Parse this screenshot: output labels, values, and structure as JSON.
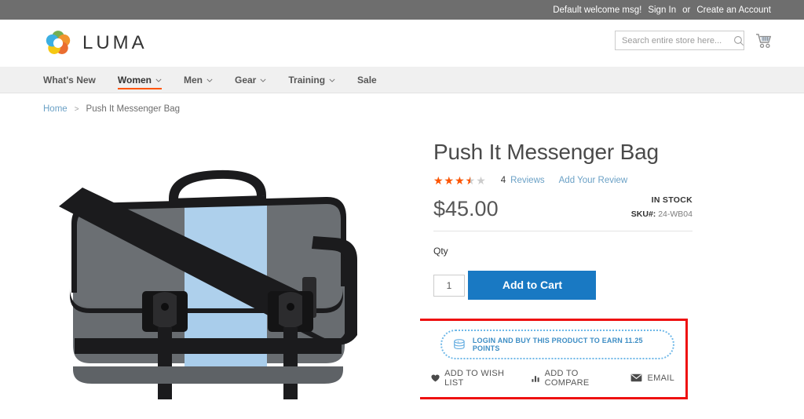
{
  "top_panel": {
    "welcome": "Default welcome msg!",
    "sign_in": "Sign In",
    "or": "or",
    "create_account": "Create an Account"
  },
  "header": {
    "logo_text": "LUMA",
    "logo_icon": "luma-flower-logo",
    "search": {
      "placeholder": "Search entire store here...",
      "value": "",
      "icon": "search-icon"
    },
    "cart_icon": "shopping-cart-icon"
  },
  "nav": {
    "items": [
      {
        "label": "What's New",
        "has_chevron": false,
        "active": false
      },
      {
        "label": "Women",
        "has_chevron": true,
        "active": true
      },
      {
        "label": "Men",
        "has_chevron": true,
        "active": false
      },
      {
        "label": "Gear",
        "has_chevron": true,
        "active": false
      },
      {
        "label": "Training",
        "has_chevron": true,
        "active": false
      },
      {
        "label": "Sale",
        "has_chevron": false,
        "active": false
      }
    ]
  },
  "breadcrumb": {
    "home": "Home",
    "separator": ">",
    "current": "Push It Messenger Bag"
  },
  "product": {
    "title": "Push It Messenger Bag",
    "rating_value": 3.5,
    "rating_max": 5,
    "rating_percent": 70,
    "review_count": "4",
    "reviews_label": "Reviews",
    "add_review_label": "Add Your Review",
    "price": "$45.00",
    "availability": "IN STOCK",
    "sku_label": "SKU#:",
    "sku_value": "24-WB04",
    "qty_label": "Qty",
    "qty_value": "1",
    "add_to_cart_label": "Add to Cart",
    "image_alt": "Push It Messenger Bag gray and light blue messenger bag"
  },
  "reward": {
    "badge_text": "LOGIN AND BUY THIS PRODUCT TO EARN 11.25 POINTS",
    "points": "11.25",
    "icon": "coin-stack-icon"
  },
  "actions": [
    {
      "label": "ADD TO WISH LIST",
      "icon": "heart-icon"
    },
    {
      "label": "ADD TO COMPARE",
      "icon": "bar-chart-icon"
    },
    {
      "label": "EMAIL",
      "icon": "envelope-icon"
    }
  ],
  "colors": {
    "top_bar": "#6e6e6e",
    "accent_orange": "#ff5501",
    "link_blue": "#6ba1c6",
    "button_blue": "#1979c3",
    "highlight_red": "#ee1111",
    "badge_blue": "#6fb8e8",
    "bag_gray": "#686c70",
    "bag_blue": "#a9cdeb",
    "bag_black": "#1b1b1d"
  }
}
